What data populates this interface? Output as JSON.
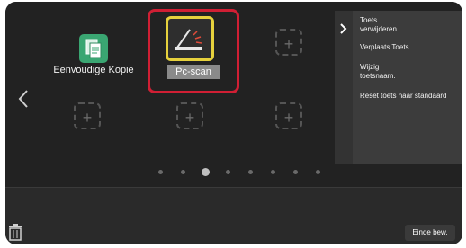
{
  "tiles": {
    "copy": {
      "label": "Eenvoudige Kopie",
      "icon": "copy-icon"
    },
    "scan": {
      "label": "Pc-scan",
      "icon": "scan-to-pc-icon"
    }
  },
  "pager": {
    "page_count": 8,
    "active_page": 3
  },
  "menu": {
    "items": [
      "Toets\nverwijderen",
      "Verplaats Toets",
      "Wijzig\ntoetsnaam.",
      "Reset toets naar standaard"
    ]
  },
  "bottom_bar": {
    "done_label": "Einde bew."
  },
  "colors": {
    "highlight_border": "#d01f34",
    "selected_icon_border": "#e6d13d",
    "copy_icon_green": "#3aa672"
  }
}
